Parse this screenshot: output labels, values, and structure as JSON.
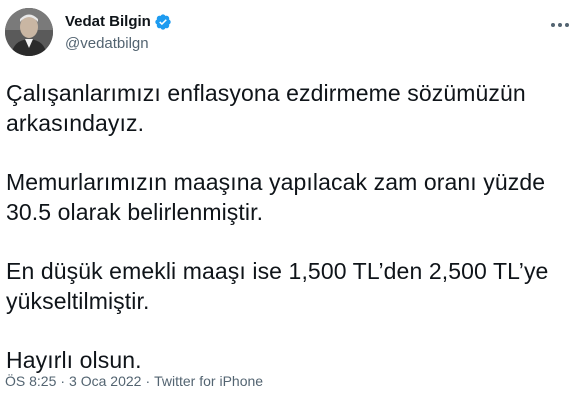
{
  "author": {
    "display_name": "Vedat Bilgin",
    "handle": "@vedatbilgn",
    "avatar_icon": "profile-photo",
    "verified_icon": "verified-badge-icon",
    "verified_color": "#1d9bf0"
  },
  "menu": {
    "more_icon": "more-horizontal-icon"
  },
  "tweet": {
    "paragraphs": [
      "Çalışanlarımızı enflasyona ezdirmeme sözümüzün\narkasındayız.",
      "Memurlarımızın maaşına yapılacak zam oranı yüzde\n30.5 olarak belirlenmiştir.",
      "En düşük emekli maaşı ise 1,500 TL’den 2,500 TL’ye\nyükseltilmiştir.",
      "Hayırlı olsun."
    ]
  },
  "meta": {
    "time": "ÖS 8:25",
    "separator": "·",
    "date": "3 Oca 2022",
    "source": "Twitter for iPhone"
  }
}
